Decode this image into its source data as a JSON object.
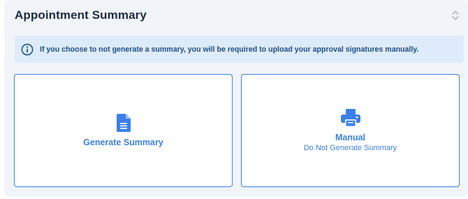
{
  "section": {
    "title": "Appointment Summary",
    "collapse_icon": "chevron-up-down-icon"
  },
  "info_banner": {
    "icon": "info-circle-icon",
    "text": "If you choose to not generate a summary, you will be required to upload your approval signatures manually."
  },
  "options": [
    {
      "icon": "document-icon",
      "title": "Generate Summary",
      "subtitle": ""
    },
    {
      "icon": "printer-icon",
      "title": "Manual",
      "subtitle": "Do Not Generate Summary"
    }
  ],
  "colors": {
    "accent": "#3b80e6",
    "panel_bg": "#f1f4f8",
    "banner_bg": "#deebfb",
    "banner_text": "#1f4f87",
    "title_text": "#1d2d44"
  }
}
